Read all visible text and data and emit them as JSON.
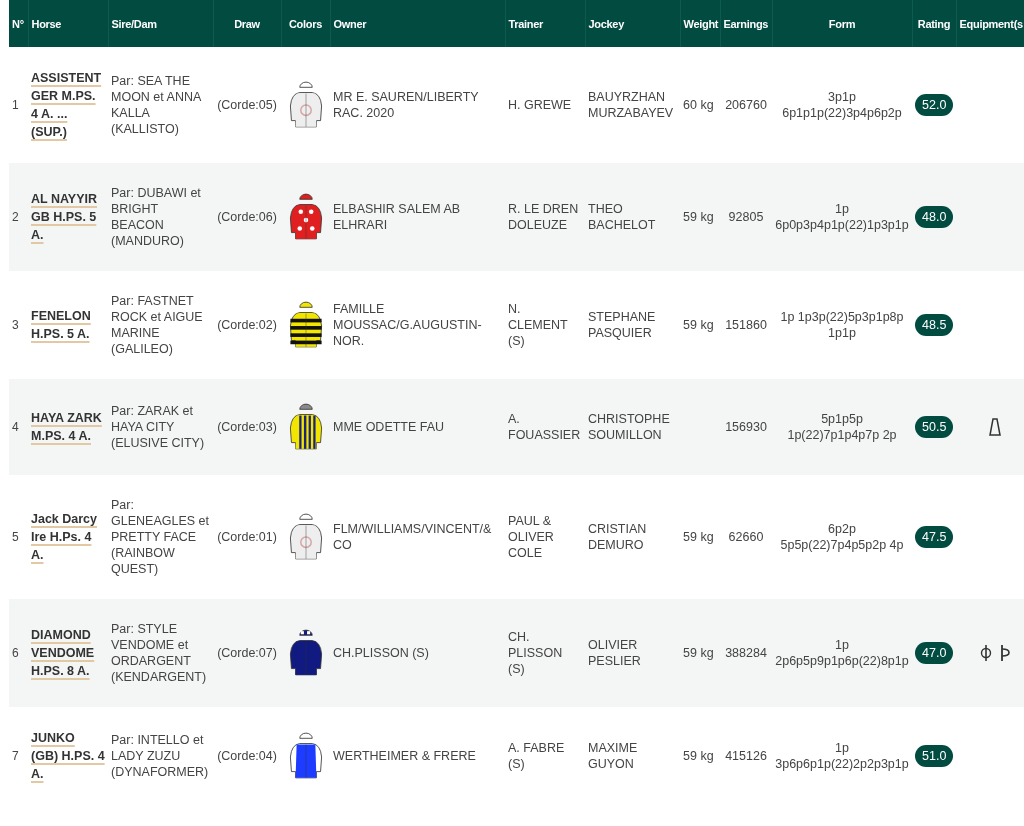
{
  "table": {
    "columns": [
      "N°",
      "Horse",
      "Sire/Dam",
      "Draw",
      "Colors",
      "Owner",
      "Trainer",
      "Jockey",
      "Weight",
      "Earnings",
      "Form",
      "Rating",
      "Equipment(s"
    ],
    "rows": [
      {
        "number": "1",
        "horse": "ASSISTENT GER M.PS. 4 A. ... (SUP.)",
        "sire_dam": "Par: SEA THE MOON et ANNA KALLA (KALLISTO)",
        "draw": "(Corde:05)",
        "silks": {
          "kind": "emblem",
          "color": "#eeeeee"
        },
        "owner": "MR E. SAUREN/LIBERTY RAC. 2020",
        "trainer": "H. GREWE",
        "jockey": "BAUYRZHAN MURZABAYEV",
        "weight": "60 kg",
        "earnings": "206760",
        "form": "3p1p 6p1p1p(22)3p4p6p2p",
        "rating": "52.0",
        "equipment": []
      },
      {
        "number": "2",
        "horse": "AL NAYYIR GB H.PS. 5 A.",
        "sire_dam": "Par: DUBAWI et BRIGHT BEACON (MANDURO)",
        "draw": "(Corde:06)",
        "silks": {
          "kind": "stars",
          "color": "#e02020"
        },
        "owner": "ELBASHIR SALEM AB ELHRARI",
        "trainer": "R. LE DREN DOLEUZE",
        "jockey": "THEO BACHELOT",
        "weight": "59 kg",
        "earnings": "92805",
        "form": "1p 6p0p3p4p1p(22)1p3p1p",
        "rating": "48.0",
        "equipment": []
      },
      {
        "number": "3",
        "horse": "FENELON H.PS. 5 A.",
        "sire_dam": "Par: FASTNET ROCK et AIGUE MARINE (GALILEO)",
        "draw": "(Corde:02)",
        "silks": {
          "kind": "hoops",
          "color": "#f2e600"
        },
        "owner": "FAMILLE MOUSSAC/G.AUGUSTIN-NOR.",
        "trainer": "N. CLEMENT (S)",
        "jockey": "STEPHANE PASQUIER",
        "weight": "59 kg",
        "earnings": "151860",
        "form": "1p 1p3p(22)5p3p1p8p 1p1p",
        "rating": "48.5",
        "equipment": []
      },
      {
        "number": "4",
        "horse": "HAYA ZARK M.PS. 4 A.",
        "sire_dam": "Par: ZARAK et HAYA CITY (ELUSIVE CITY)",
        "draw": "(Corde:03)",
        "silks": {
          "kind": "stripes",
          "color": "#f2e600"
        },
        "owner": "MME ODETTE FAU",
        "trainer": "A. FOUASSIER",
        "jockey": "CHRISTOPHE SOUMILLON",
        "earnings": "156930",
        "form": "5p1p5p 1p(22)7p1p4p7p 2p",
        "rating": "50.5",
        "equipment": [
          {
            "kind": "cone"
          }
        ]
      },
      {
        "number": "5",
        "horse": "Jack Darcy Ire H.Ps. 4 A.",
        "sire_dam": "Par: GLENEAGLES et PRETTY FACE (RAINBOW QUEST)",
        "draw": "(Corde:01)",
        "silks": {
          "kind": "emblem",
          "color": "#eeeeee"
        },
        "owner": "FLM/WILLIAMS/VINCENT/& CO",
        "trainer": "PAUL & OLIVER COLE",
        "jockey": "CRISTIAN DEMURO",
        "weight": "59 kg",
        "earnings": "62660",
        "form": "6p2p 5p5p(22)7p4p5p2p 4p",
        "rating": "47.5",
        "equipment": []
      },
      {
        "number": "6",
        "horse": "DIAMOND VENDOME H.PS. 8 A.",
        "sire_dam": "Par: STYLE VENDOME et ORDARGENT (KENDARGENT)",
        "draw": "(Corde:07)",
        "silks": {
          "kind": "plain",
          "color": "#101a80"
        },
        "owner": "CH.PLISSON (S)",
        "trainer": "CH. PLISSON (S)",
        "jockey": "OLIVIER PESLIER",
        "weight": "59 kg",
        "earnings": "388284",
        "form": "1p 2p6p5p9p1p6p(22)8p1p",
        "rating": "47.0",
        "equipment": [
          {
            "kind": "slashed"
          },
          {
            "kind": "flag"
          }
        ]
      },
      {
        "number": "7",
        "horse": "JUNKO (GB) H.PS. 4 A.",
        "sire_dam": "Par: INTELLO et LADY ZUZU (DYNAFORMER)",
        "draw": "(Corde:04)",
        "silks": {
          "kind": "panel",
          "color": "#1e3cff"
        },
        "owner": "WERTHEIMER & FRERE",
        "trainer": "A. FABRE (S)",
        "jockey": "MAXIME GUYON",
        "weight": "59 kg",
        "earnings": "415126",
        "form": "1p 3p6p6p1p(22)2p2p3p1p",
        "rating": "51.0",
        "equipment": []
      }
    ]
  }
}
